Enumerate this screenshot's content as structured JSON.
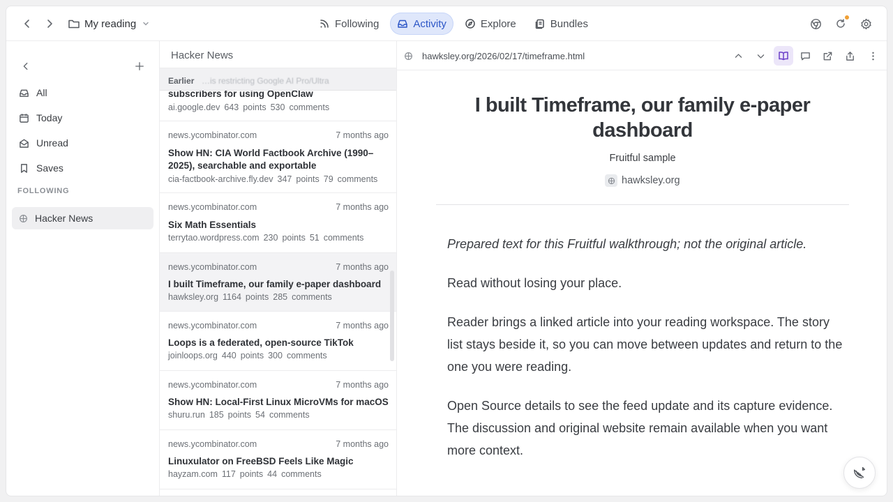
{
  "topbar": {
    "folder_name": "My reading",
    "tabs": [
      {
        "label": "Following",
        "icon": "rss-icon"
      },
      {
        "label": "Activity",
        "icon": "inbox-icon"
      },
      {
        "label": "Explore",
        "icon": "compass-icon"
      },
      {
        "label": "Bundles",
        "icon": "bundle-icon"
      }
    ],
    "active_tab": "Activity",
    "icons": [
      "back-icon",
      "forward-icon",
      "folder-icon",
      "chevron-down-icon",
      "chrome-icon",
      "refresh-icon",
      "gear-icon"
    ],
    "accent_color": "#2d57c7",
    "notification_dot_color": "#f0a036"
  },
  "sidebar": {
    "items": [
      {
        "label": "All",
        "icon": "inbox-icon"
      },
      {
        "label": "Today",
        "icon": "calendar-icon"
      },
      {
        "label": "Unread",
        "icon": "mail-open-icon"
      },
      {
        "label": "Saves",
        "icon": "bookmark-icon"
      }
    ],
    "section_label": "FOLLOWING",
    "feeds": [
      {
        "label": "Hacker News",
        "icon": "globe-icon",
        "selected": true
      }
    ]
  },
  "list": {
    "title": "Hacker News",
    "group_label": "Earlier",
    "group_ghost_text": "…is restricting Google AI Pro/Ultra",
    "stories": [
      {
        "source": "",
        "time": "",
        "title": "subscribers for using OpenClaw",
        "domain": "ai.google.dev",
        "points": "643",
        "points_label": "points",
        "comments": "530",
        "comments_label": "comments"
      },
      {
        "source": "news.ycombinator.com",
        "time": "7 months ago",
        "title": "Show HN: CIA World Factbook Archive (1990–2025), searchable and exportable",
        "domain": "cia-factbook-archive.fly.dev",
        "points": "347",
        "points_label": "points",
        "comments": "79",
        "comments_label": "comments"
      },
      {
        "source": "news.ycombinator.com",
        "time": "7 months ago",
        "title": "Six Math Essentials",
        "domain": "terrytao.wordpress.com",
        "points": "230",
        "points_label": "points",
        "comments": "51",
        "comments_label": "comments"
      },
      {
        "source": "news.ycombinator.com",
        "time": "7 months ago",
        "title": "I built Timeframe, our family e-paper dashboard",
        "domain": "hawksley.org",
        "points": "1164",
        "points_label": "points",
        "comments": "285",
        "comments_label": "comments",
        "selected": true
      },
      {
        "source": "news.ycombinator.com",
        "time": "7 months ago",
        "title": "Loops is a federated, open-source TikTok",
        "domain": "joinloops.org",
        "points": "440",
        "points_label": "points",
        "comments": "300",
        "comments_label": "comments"
      },
      {
        "source": "news.ycombinator.com",
        "time": "7 months ago",
        "title": "Show HN: Local-First Linux MicroVMs for macOS",
        "domain": "shuru.run",
        "points": "185",
        "points_label": "points",
        "comments": "54",
        "comments_label": "comments"
      },
      {
        "source": "news.ycombinator.com",
        "time": "7 months ago",
        "title": "Linuxulator on FreeBSD Feels Like Magic",
        "domain": "hayzam.com",
        "points": "117",
        "points_label": "points",
        "comments": "44",
        "comments_label": "comments"
      }
    ]
  },
  "reader": {
    "url": "hawksley.org/2026/02/17/timeframe.html",
    "title": "I built Timeframe, our family e-paper dashboard",
    "feed_name": "Fruitful sample",
    "site": "hawksley.org",
    "paragraphs": [
      "Prepared text for this Fruitful walkthrough; not the original article.",
      "Read without losing your place.",
      "Reader brings a linked article into your reading workspace. The story list stays beside it, so you can move between updates and return to the one you were reading.",
      "Open Source details to see the feed update and its capture evidence. The discussion and original website remain available when you want more context."
    ],
    "toolbar_icons": [
      "chevron-up-icon",
      "chevron-down-icon",
      "reader-mode-icon",
      "comment-icon",
      "external-link-icon",
      "share-icon",
      "more-icon"
    ],
    "reader_mode_active": true,
    "fab_icon": "fruit-slice-icon"
  }
}
